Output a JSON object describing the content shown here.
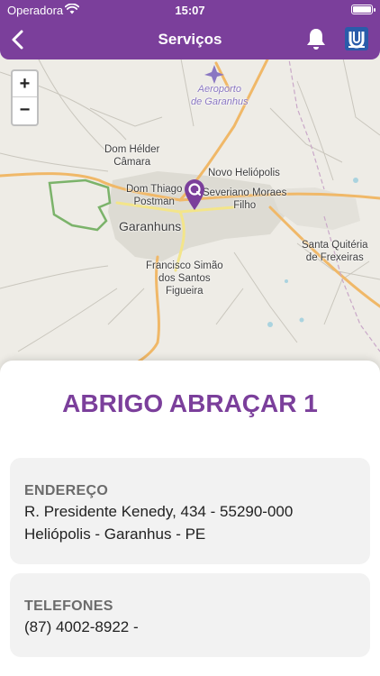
{
  "status_bar": {
    "carrier": "Operadora",
    "time": "15:07"
  },
  "nav": {
    "title": "Serviços"
  },
  "map": {
    "zoom_in": "+",
    "zoom_out": "−",
    "labels": {
      "airport_line1": "Aeroporto",
      "airport_line2": "de Garanhus",
      "dom_helder_1": "Dom Hélder",
      "dom_helder_2": "Câmara",
      "novo_heliopolis": "Novo Heliópolis",
      "dom_thiago_1": "Dom Thiago",
      "dom_thiago_2": "Postman",
      "severiano_1": "Severiano Moraes",
      "severiano_2": "Filho",
      "city": "Garanhuns",
      "santa_quiteria_1": "Santa Quitéria",
      "santa_quiteria_2": "de Frexeiras",
      "francisco_1": "Francisco Simão",
      "francisco_2": "dos Santos",
      "francisco_3": "Figueira"
    }
  },
  "place": {
    "name": "ABRIGO ABRAÇAR 1",
    "address_label": "ENDEREÇO",
    "address_line1": "R. Presidente Kenedy, 434 - 55290-000",
    "address_line2": "Heliópolis - Garanhus - PE",
    "phone_label": "TELEFONES",
    "phone": "(87) 4002-8922 -"
  },
  "colors": {
    "accent": "#7b3f9b",
    "card_bg": "#f2f2f2"
  }
}
